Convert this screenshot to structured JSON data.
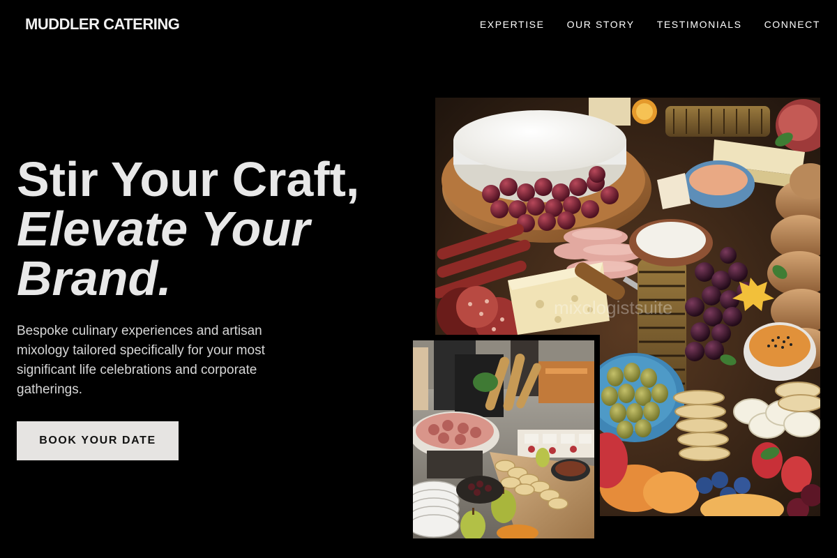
{
  "header": {
    "brand": "MUDDLER CATERING",
    "nav": [
      "EXPERTISE",
      "OUR STORY",
      "TESTIMONIALS",
      "CONNECT"
    ]
  },
  "hero": {
    "headline_line1": "Stir Your Craft,",
    "headline_line2": "Elevate Your",
    "headline_line3": "Brand.",
    "subtitle": "Bespoke culinary experiences and artisan mixology tailored specifically for your most significant life celebrations and corporate gatherings.",
    "cta_label": "BOOK YOUR DATE"
  },
  "images": {
    "main_watermark": "mixologistsuite"
  },
  "colors": {
    "background": "#000000",
    "text": "#e8e8e8",
    "cta_bg": "#e6e4e2",
    "cta_text": "#111111"
  }
}
